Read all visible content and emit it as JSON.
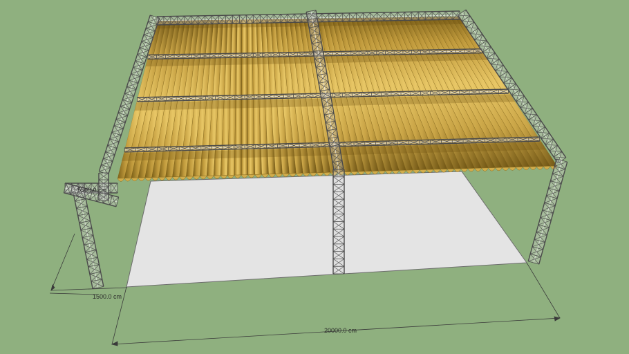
{
  "viewport": {
    "background": "#8fb07f",
    "colors": {
      "floor": "#e4e4e4",
      "floor_edge": "#6c6c6c",
      "truss_fill": "#d4d4d4",
      "truss_stroke": "#4a4a4a",
      "fabric_light": "#e2bd57",
      "fabric_dark": "#8a6c1d",
      "dimension_line": "#3a3a3a"
    }
  },
  "dimensions": {
    "height_label": "5500.0 cm",
    "depth_label": "1500.0 cm",
    "width_label": "20000.0 cm"
  }
}
